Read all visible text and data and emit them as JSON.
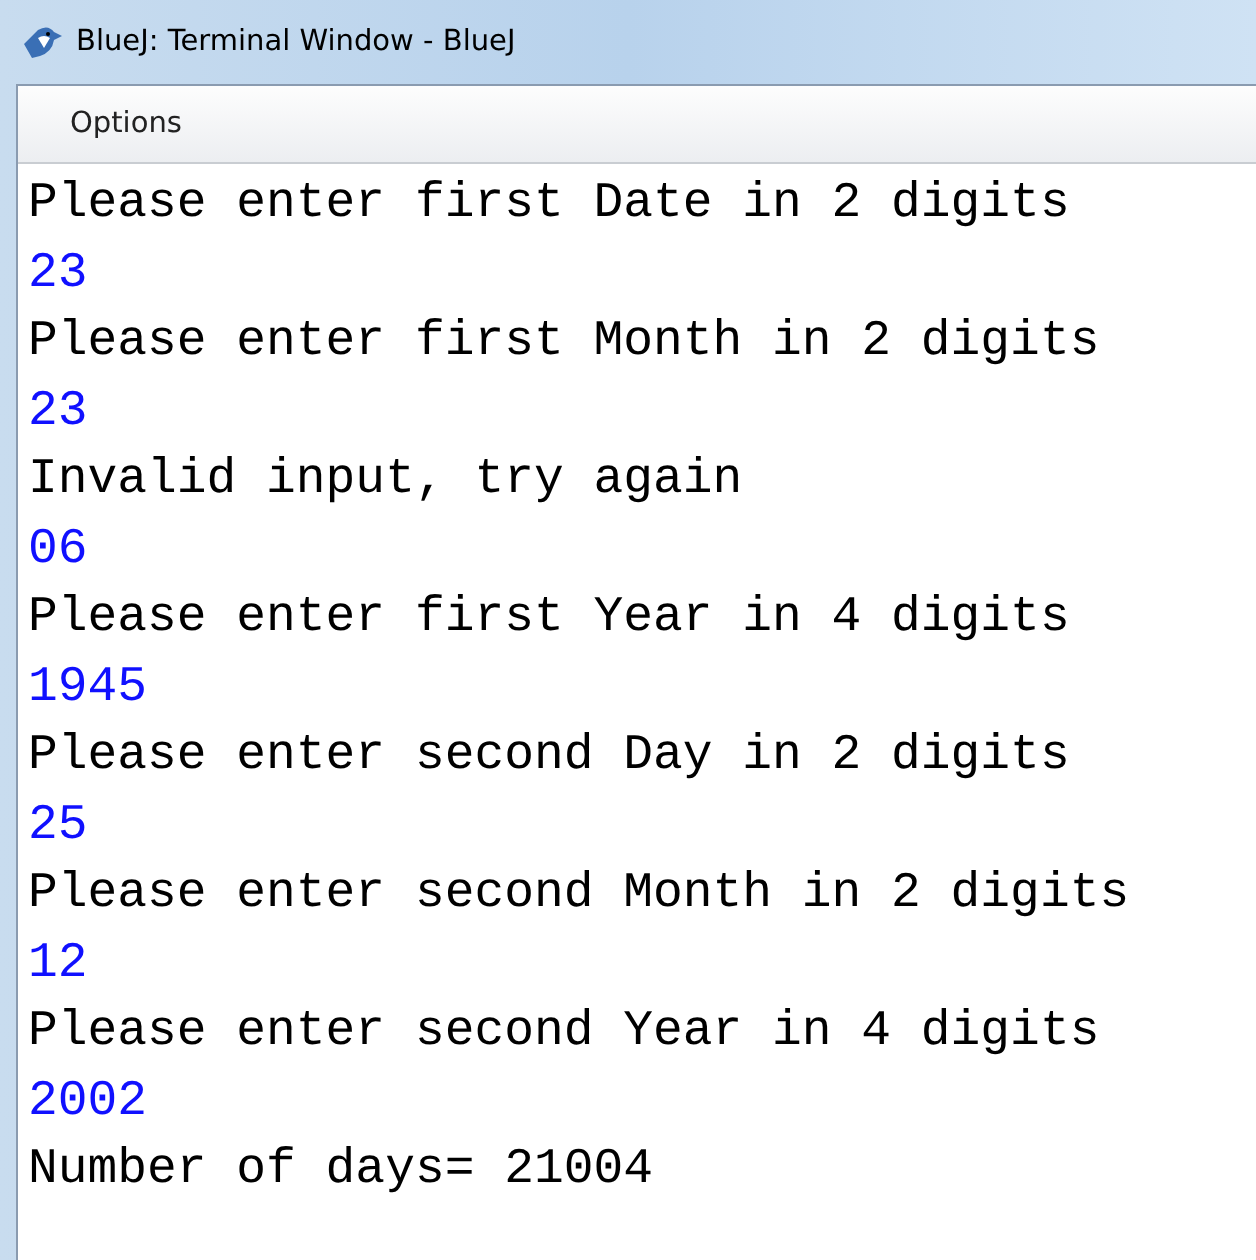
{
  "window": {
    "title": "BlueJ: Terminal Window - BlueJ"
  },
  "menu": [
    "Options"
  ],
  "terminal": [
    {
      "kind": "output",
      "text": "Please enter first Date in 2 digits"
    },
    {
      "kind": "input",
      "text": "23"
    },
    {
      "kind": "output",
      "text": "Please enter first Month in 2 digits"
    },
    {
      "kind": "input",
      "text": "23"
    },
    {
      "kind": "output",
      "text": "Invalid input, try again"
    },
    {
      "kind": "input",
      "text": "06"
    },
    {
      "kind": "output",
      "text": "Please enter first Year in 4 digits"
    },
    {
      "kind": "input",
      "text": "1945"
    },
    {
      "kind": "output",
      "text": "Please enter second Day in 2 digits"
    },
    {
      "kind": "input",
      "text": "25"
    },
    {
      "kind": "output",
      "text": "Please enter second Month in 2 digits"
    },
    {
      "kind": "input",
      "text": "12"
    },
    {
      "kind": "output",
      "text": "Please enter second Year in 4 digits"
    },
    {
      "kind": "input",
      "text": "2002"
    },
    {
      "kind": "output",
      "text": "Number of days= 21004"
    }
  ]
}
